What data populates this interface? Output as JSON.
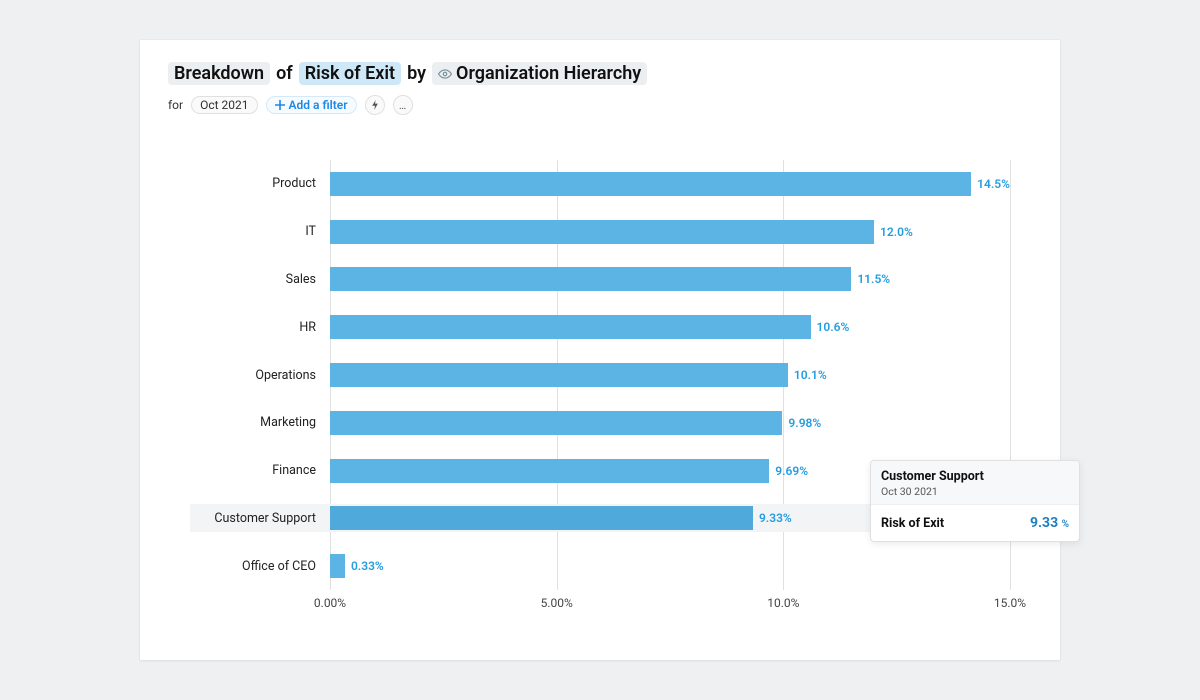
{
  "header": {
    "breakdown_label": "Breakdown",
    "of_label": "of",
    "metric_label": "Risk of Exit",
    "by_label": "by",
    "dimension_label": "Organization Hierarchy"
  },
  "sub": {
    "for_label": "for",
    "period": "Oct 2021",
    "add_filter_label": "Add a filter"
  },
  "axis_ticks": [
    "0.00%",
    "5.00%",
    "10.0%",
    "15.0%"
  ],
  "chart_data": {
    "type": "bar",
    "orientation": "horizontal",
    "title": "Breakdown of Risk of Exit by Organization Hierarchy",
    "xlabel": "",
    "ylabel": "",
    "xlim": [
      0,
      15
    ],
    "categories": [
      "Product",
      "IT",
      "Sales",
      "HR",
      "Operations",
      "Marketing",
      "Finance",
      "Customer Support",
      "Office of CEO"
    ],
    "values": [
      14.5,
      12.0,
      11.5,
      10.6,
      10.1,
      9.98,
      9.69,
      9.33,
      0.33
    ],
    "value_labels": [
      "14.5%",
      "12.0%",
      "11.5%",
      "10.6%",
      "10.1%",
      "9.98%",
      "9.69%",
      "9.33%",
      "0.33%"
    ]
  },
  "highlight_index": 7,
  "tooltip": {
    "title": "Customer Support",
    "date": "Oct 30 2021",
    "metric": "Risk of Exit",
    "value": "9.33",
    "unit": "%"
  },
  "colors": {
    "bar": "#5bb4e3",
    "value_text": "#249de0",
    "accent_blue": "#1e88e5"
  }
}
